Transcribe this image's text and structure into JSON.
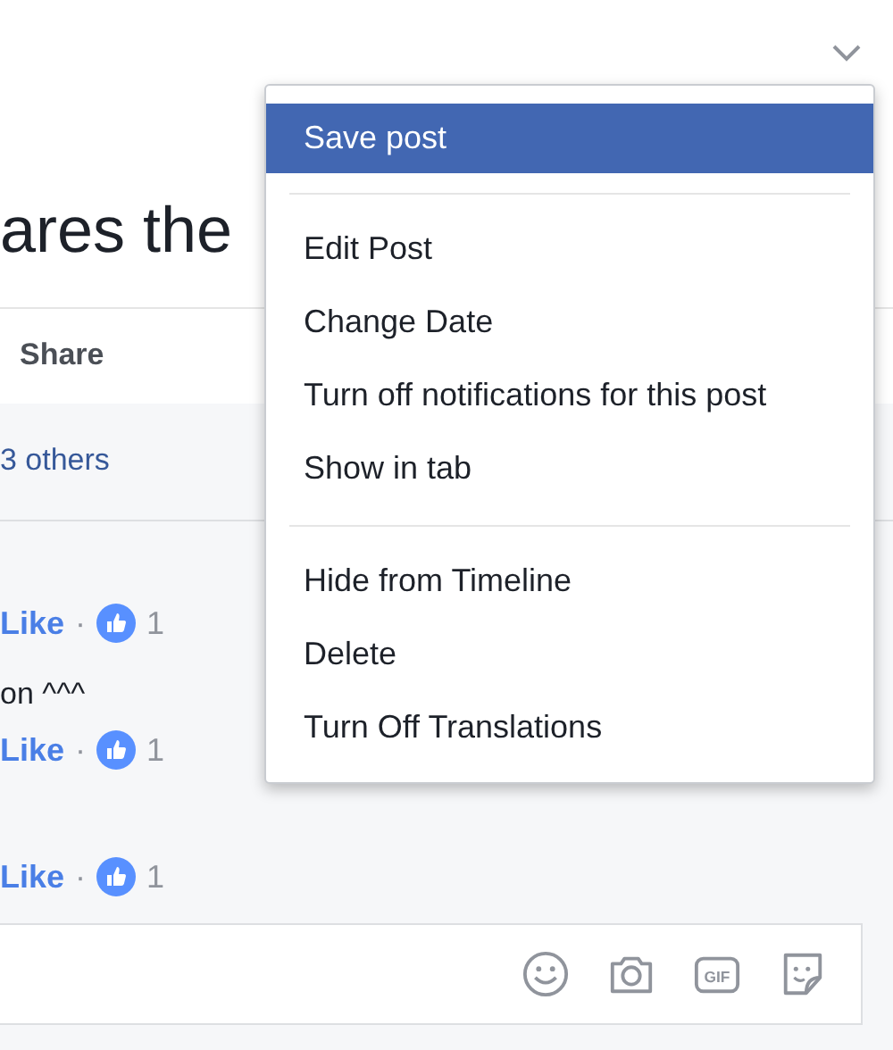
{
  "post": {
    "text": "ares the",
    "share_label": "Share",
    "likes_link": "3 others"
  },
  "comments": [
    {
      "like_label": "Like",
      "separator": "·",
      "like_count": "1"
    },
    {
      "text": "on ^^^",
      "like_label": "Like",
      "separator": "·",
      "like_count": "1"
    },
    {
      "like_label": "Like",
      "separator": "·",
      "like_count": "1"
    }
  ],
  "composer": {
    "gif_label": "GIF"
  },
  "menu": {
    "sections": [
      [
        {
          "label": "Save post",
          "selected": true
        }
      ],
      [
        {
          "label": "Edit Post",
          "selected": false
        },
        {
          "label": "Change Date",
          "selected": false
        },
        {
          "label": "Turn off notifications for this post",
          "selected": false
        },
        {
          "label": "Show in tab",
          "selected": false
        }
      ],
      [
        {
          "label": "Hide from Timeline",
          "selected": false
        },
        {
          "label": "Delete",
          "selected": false
        },
        {
          "label": "Turn Off Translations",
          "selected": false
        }
      ]
    ]
  }
}
